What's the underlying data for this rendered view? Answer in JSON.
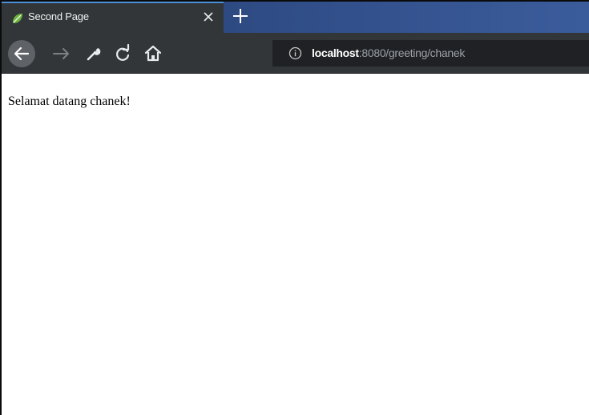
{
  "browser": {
    "tab": {
      "title": "Second Page",
      "favicon": "spring-leaf-icon",
      "close_icon": "close-icon"
    },
    "new_tab_icon": "plus-icon",
    "toolbar": {
      "back_icon": "back-arrow-icon",
      "forward_icon": "forward-arrow-icon",
      "tools_icon": "wrench-icon",
      "reload_icon": "reload-icon",
      "home_icon": "home-icon"
    },
    "address_bar": {
      "info_icon": "info-icon",
      "host": "localhost",
      "path": ":8080/greeting/chanek"
    },
    "colors": {
      "tab_strip": "#2f4c86",
      "toolbar": "#323639",
      "address_bar": "#202124",
      "tab_accent": "#4a90d9"
    }
  },
  "page": {
    "greeting": "Selamat datang chanek!"
  }
}
